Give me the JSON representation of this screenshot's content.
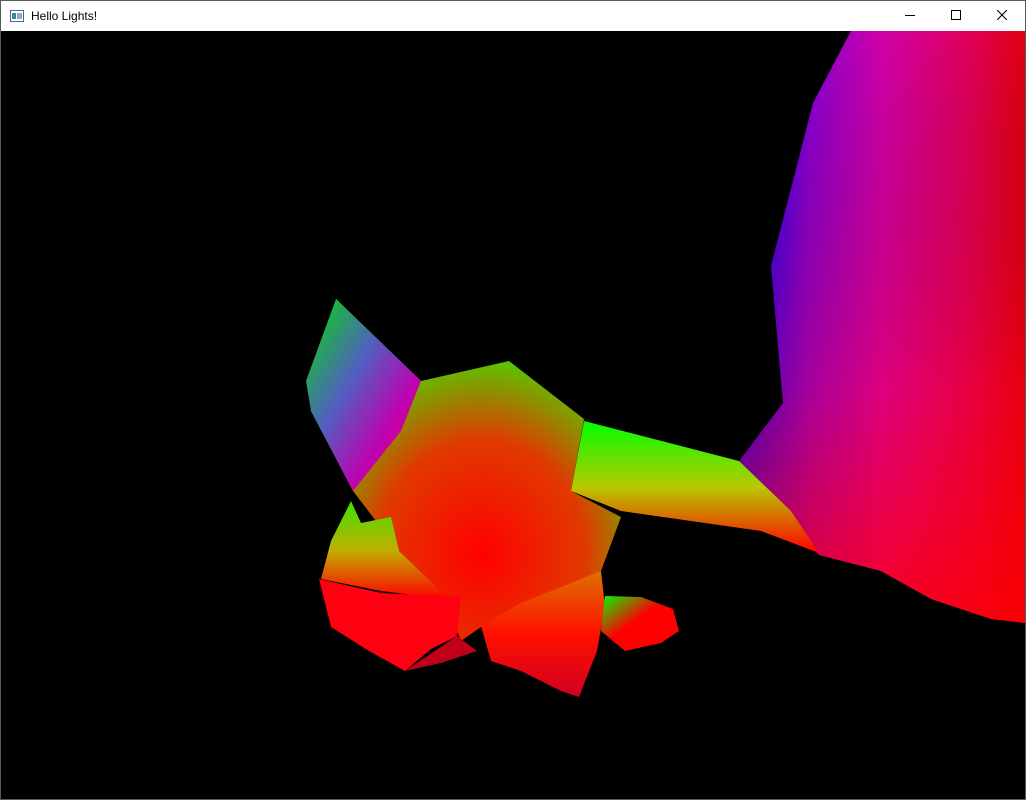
{
  "window": {
    "title": "Hello Lights!",
    "icon": "app-window-icon",
    "controls": {
      "minimize_icon": "minimize-icon",
      "maximize_icon": "maximize-icon",
      "close_icon": "close-icon"
    }
  },
  "scene": {
    "background_color": "#000000",
    "palette": {
      "red": "#ff0000",
      "green": "#00ff00",
      "blue": "#0000ff",
      "magenta": "#d000a8",
      "yellow": "#c8c800"
    }
  }
}
